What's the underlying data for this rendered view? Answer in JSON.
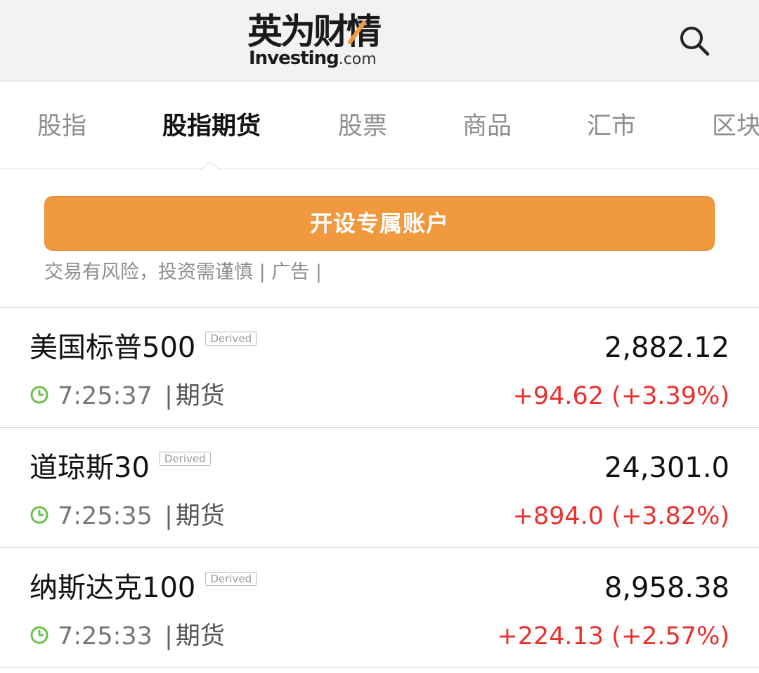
{
  "header": {
    "logo_cn": "英为财情",
    "logo_brand": "Investing",
    "logo_domain": ".com",
    "search_icon": "search-icon",
    "logo_accent_color": "#f0993f"
  },
  "tabs": [
    {
      "label": "股指",
      "active": false
    },
    {
      "label": "股指期货",
      "active": true
    },
    {
      "label": "股票",
      "active": false
    },
    {
      "label": "商品",
      "active": false
    },
    {
      "label": "汇市",
      "active": false
    },
    {
      "label": "区块",
      "active": false
    }
  ],
  "cta": {
    "label": "开设专属账户",
    "color": "#f0993f"
  },
  "disclaimer": "交易有风险，投资需谨慎 | 广告 |",
  "quotes": [
    {
      "name": "美国标普500",
      "badge": "Derived",
      "price": "2,882.12",
      "time": "7:25:37",
      "separator": "|",
      "kind": "期货",
      "change": "+94.62 (+3.39%)"
    },
    {
      "name": "道琼斯30",
      "badge": "Derived",
      "price": "24,301.0",
      "time": "7:25:35",
      "separator": "|",
      "kind": "期货",
      "change": "+894.0 (+3.82%)"
    },
    {
      "name": "纳斯达克100",
      "badge": "Derived",
      "price": "8,958.38",
      "time": "7:25:33",
      "separator": "|",
      "kind": "期货",
      "change": "+224.13 (+2.57%)"
    }
  ],
  "colors": {
    "positive_change": "#e8312f",
    "clock_icon": "#6cc04a"
  },
  "icons": {
    "clock": "clock-icon"
  }
}
